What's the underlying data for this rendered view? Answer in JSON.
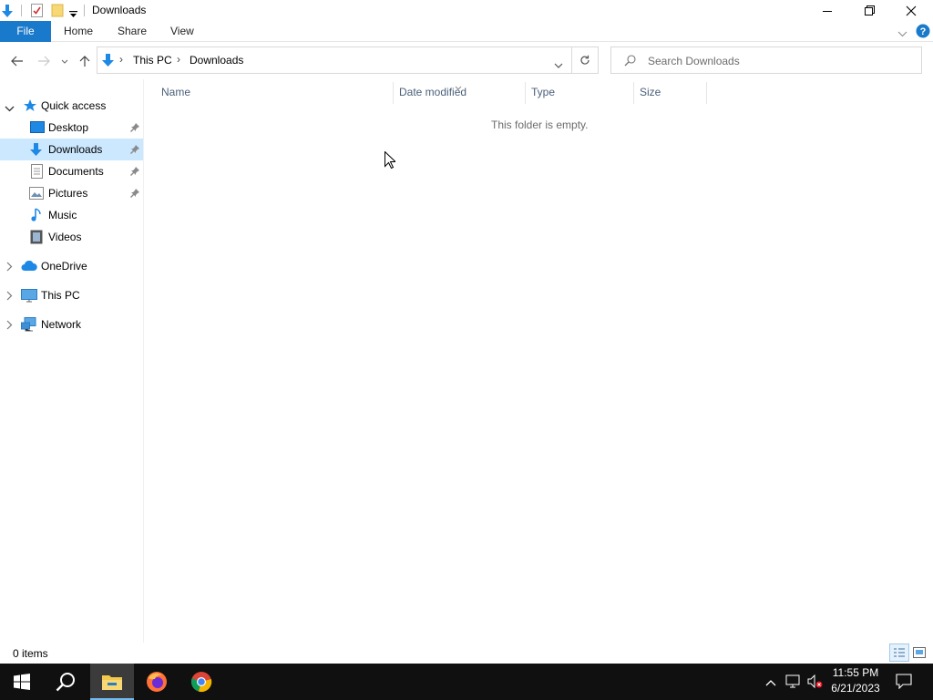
{
  "window": {
    "title": "Downloads"
  },
  "ribbon": {
    "tabs": [
      "File",
      "Home",
      "Share",
      "View"
    ]
  },
  "address": {
    "crumbs": [
      "This PC",
      "Downloads"
    ],
    "separator": "›"
  },
  "search": {
    "placeholder": "Search Downloads"
  },
  "nav": {
    "quick_access": "Quick access",
    "items": [
      "Desktop",
      "Downloads",
      "Documents",
      "Pictures",
      "Music",
      "Videos"
    ],
    "roots": [
      "OneDrive",
      "This PC",
      "Network"
    ]
  },
  "columns": [
    "Name",
    "Date modified",
    "Type",
    "Size"
  ],
  "content": {
    "empty_message": "This folder is empty."
  },
  "status": {
    "item_count": "0 items"
  },
  "clock": {
    "time": "11:55 PM",
    "date": "6/21/2023"
  },
  "colors": {
    "accent": "#1979ca",
    "selection": "#cce8ff",
    "taskbar": "#101010"
  }
}
